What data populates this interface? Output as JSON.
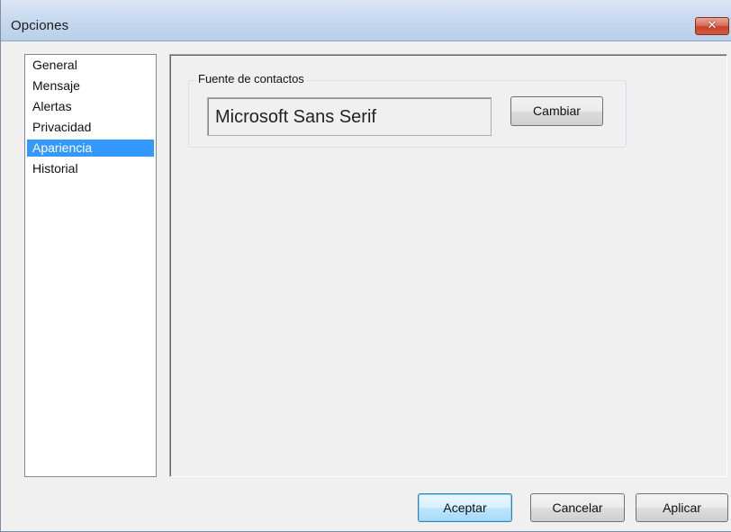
{
  "window": {
    "title": "Opciones",
    "close_glyph": "✕"
  },
  "nav": {
    "items": [
      {
        "label": "General",
        "selected": false
      },
      {
        "label": "Mensaje",
        "selected": false
      },
      {
        "label": "Alertas",
        "selected": false
      },
      {
        "label": "Privacidad",
        "selected": false
      },
      {
        "label": "Apariencia",
        "selected": true
      },
      {
        "label": "Historial",
        "selected": false
      }
    ]
  },
  "appearance": {
    "group_label": "Fuente de contactos",
    "font_value": "Microsoft Sans Serif",
    "change_button": "Cambiar"
  },
  "footer": {
    "accept_label": "Aceptar",
    "cancel_label": "Cancelar",
    "apply_label": "Aplicar"
  },
  "colors": {
    "selection": "#3399ff",
    "close_button": "#c8432c"
  }
}
